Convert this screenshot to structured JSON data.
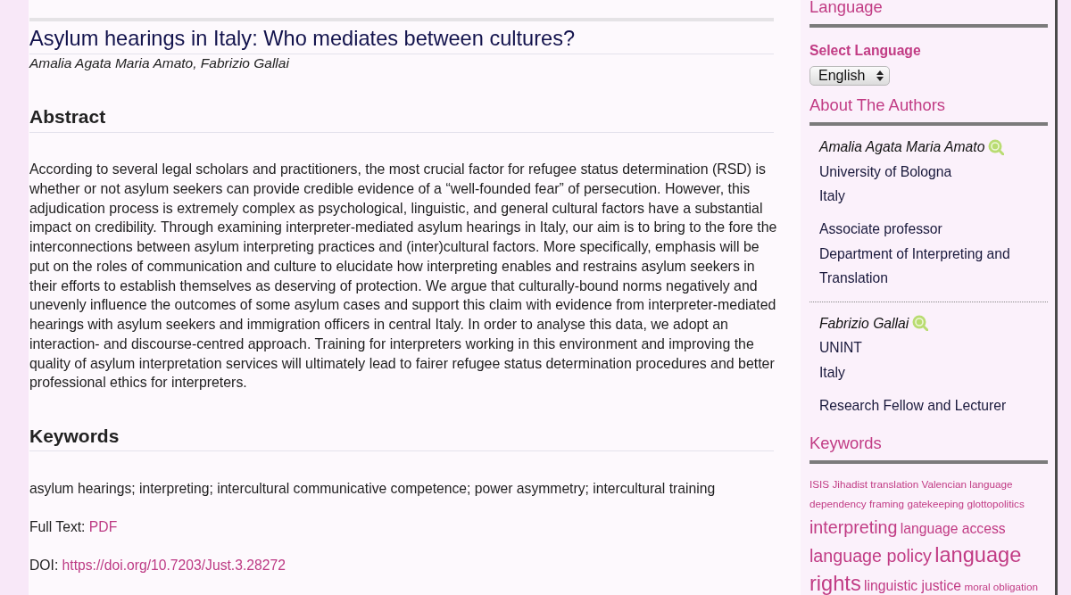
{
  "article": {
    "title": "Asylum hearings in Italy: Who mediates between cultures?",
    "authors": "Amalia Agata Maria Amato, Fabrizio Gallai",
    "abstract": {
      "heading": "Abstract",
      "text": "According to several legal scholars and practitioners, the most crucial factor for refugee status determination (RSD) is whether or not asylum seekers can provide credible evidence of a “well-founded fear” of persecution. However, this adjudication process is extremely complex as psychological, linguistic, and general cultural factors have a substantial impact on credibility. Through examining interpreter-mediated asylum hearings in Italy, our aim is to bring to the fore the interconnections between asylum interpreting practices and (inter)cultural factors. More specifically, emphasis will be put on the roles of communication and culture to elucidate how interpreting enables and restrains asylum seekers in their efforts to establish themselves as deserving of protection. We argue that culturally-bound norms negatively and unevenly influence the outcomes of some asylum cases and support this claim with evidence from interpreter-mediated hearings with asylum seekers and immigration officers in central Italy. In order to analyse this data, we adopt an interaction- and discourse-centred approach. Training for interpreters working in this environment and improving the quality of asylum interpretation services will ultimately lead to fairer refugee status determination procedures and better professional ethics for interpreters."
    },
    "keywords": {
      "heading": "Keywords",
      "text": "asylum hearings; interpreting; intercultural communicative competence; power asymmetry; intercultural training"
    },
    "full_text": {
      "label": "Full Text:",
      "link": "PDF"
    },
    "doi": {
      "label": "DOI:",
      "link": "https://doi.org/10.7203/Just.3.28272"
    }
  },
  "sidebar": {
    "language": {
      "heading": "Language",
      "label": "Select Language",
      "select": {
        "value": "English"
      }
    },
    "authors": {
      "heading": "About The Authors",
      "items": [
        {
          "name": "Amalia Agata Maria Amato",
          "affiliation": "University of Bologna",
          "country": "Italy",
          "bio": [
            "Associate professor",
            "Department of Interpreting and Translation"
          ]
        },
        {
          "name": "Fabrizio Gallai",
          "affiliation": "UNINT",
          "country": "Italy",
          "bio": [
            "Research Fellow and Lecturer"
          ]
        }
      ]
    },
    "keyword_cloud": {
      "heading": "Keywords",
      "tags": [
        {
          "text": "ISIS",
          "kind": "small"
        },
        {
          "text": "Jihadist translation",
          "kind": "small"
        },
        {
          "text": "Valencian language",
          "kind": "small"
        },
        {
          "text": "dependency",
          "kind": "small"
        },
        {
          "text": "framing",
          "kind": "small"
        },
        {
          "text": "gatekeeping",
          "kind": "small"
        },
        {
          "text": "glottopolitics",
          "kind": "small"
        },
        {
          "text": "interpreting",
          "kind": "large"
        },
        {
          "text": "language access",
          "kind": "medium"
        },
        {
          "text": "language policy",
          "kind": "large"
        },
        {
          "text": "language rights",
          "kind": "largest"
        },
        {
          "text": "linguistic justice",
          "kind": "medium"
        },
        {
          "text": "moral obligation",
          "kind": "small"
        }
      ]
    }
  }
}
